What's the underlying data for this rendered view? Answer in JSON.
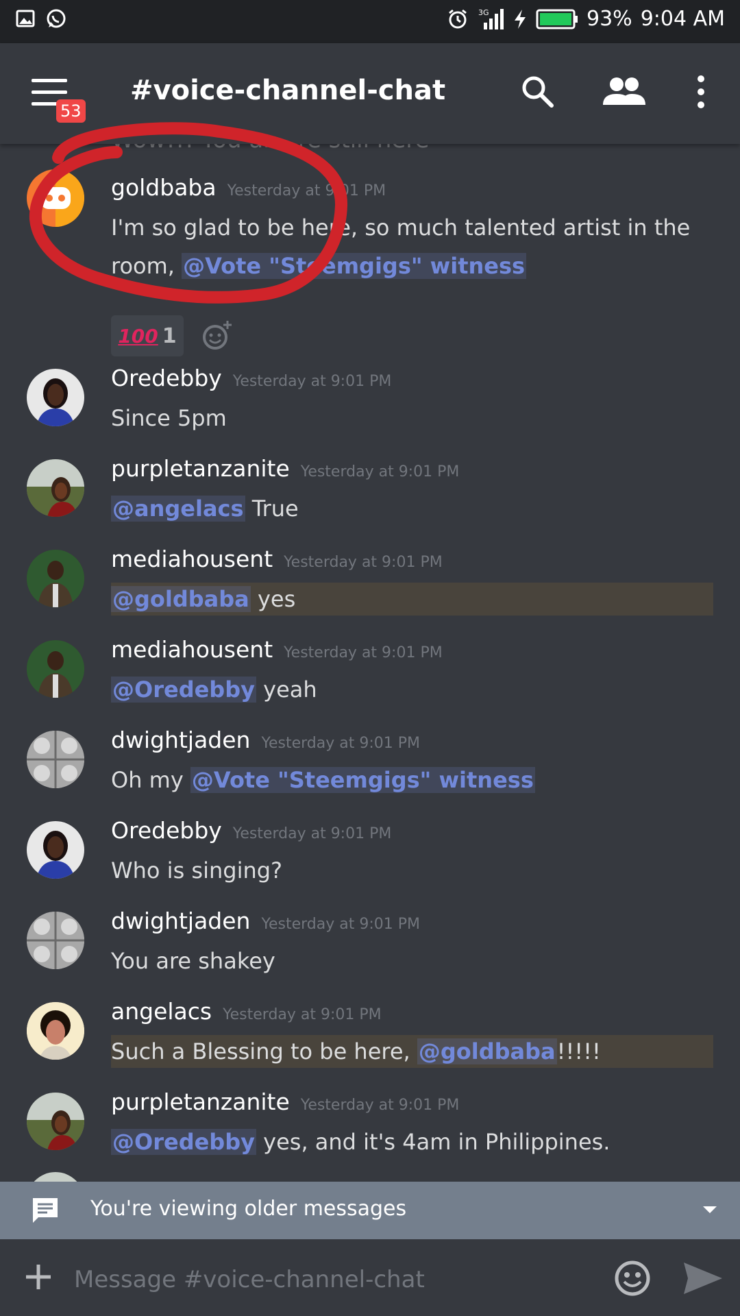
{
  "status_bar": {
    "battery": "93%",
    "time": "9:04 AM",
    "network": "3G"
  },
  "header": {
    "menu_badge": "53",
    "channel_title": "#voice-channel-chat"
  },
  "partial_message": "Wow!!! You all are still here",
  "messages": [
    {
      "user": "goldbaba",
      "timestamp": "Yesterday at 9:01 PM",
      "text_before": "I'm so glad to be here,  so much talented artist in the",
      "text_line2": "room, ",
      "mention": "@Vote \"Steemgigs\" witness",
      "reaction_emoji": "100",
      "reaction_count": "1"
    },
    {
      "user": "Oredebby",
      "timestamp": "Yesterday at 9:01 PM",
      "text": "Since 5pm"
    },
    {
      "user": "purpletanzanite",
      "timestamp": "Yesterday at 9:01 PM",
      "mention": "@angelacs",
      "text": " True"
    },
    {
      "user": "mediahousent",
      "timestamp": "Yesterday at 9:01 PM",
      "mention": "@goldbaba",
      "text": " yes"
    },
    {
      "user": "mediahousent",
      "timestamp": "Yesterday at 9:01 PM",
      "mention": "@Oredebby",
      "text": " yeah"
    },
    {
      "user": "dwightjaden",
      "timestamp": "Yesterday at 9:01 PM",
      "text": "Oh my ",
      "mention": "@Vote \"Steemgigs\" witness"
    },
    {
      "user": "Oredebby",
      "timestamp": "Yesterday at 9:01 PM",
      "text": "Who is singing?"
    },
    {
      "user": "dwightjaden",
      "timestamp": "Yesterday at 9:01 PM",
      "text": "You are shakey"
    },
    {
      "user": "angelacs",
      "timestamp": "Yesterday at 9:01 PM",
      "text": "Such a Blessing to be here, ",
      "mention": "@goldbaba",
      "text_after": "!!!!!"
    },
    {
      "user": "purpletanzanite",
      "timestamp": "Yesterday at 9:01 PM",
      "mention": "@Oredebby",
      "text": "  yes, and it's 4am in Philippines."
    }
  ],
  "older_messages": {
    "label": "You're viewing older messages"
  },
  "composer": {
    "placeholder": "Message #voice-channel-chat"
  },
  "colors": {
    "accent": "#7289da",
    "background": "#36393f",
    "annotation": "#d0242a"
  }
}
